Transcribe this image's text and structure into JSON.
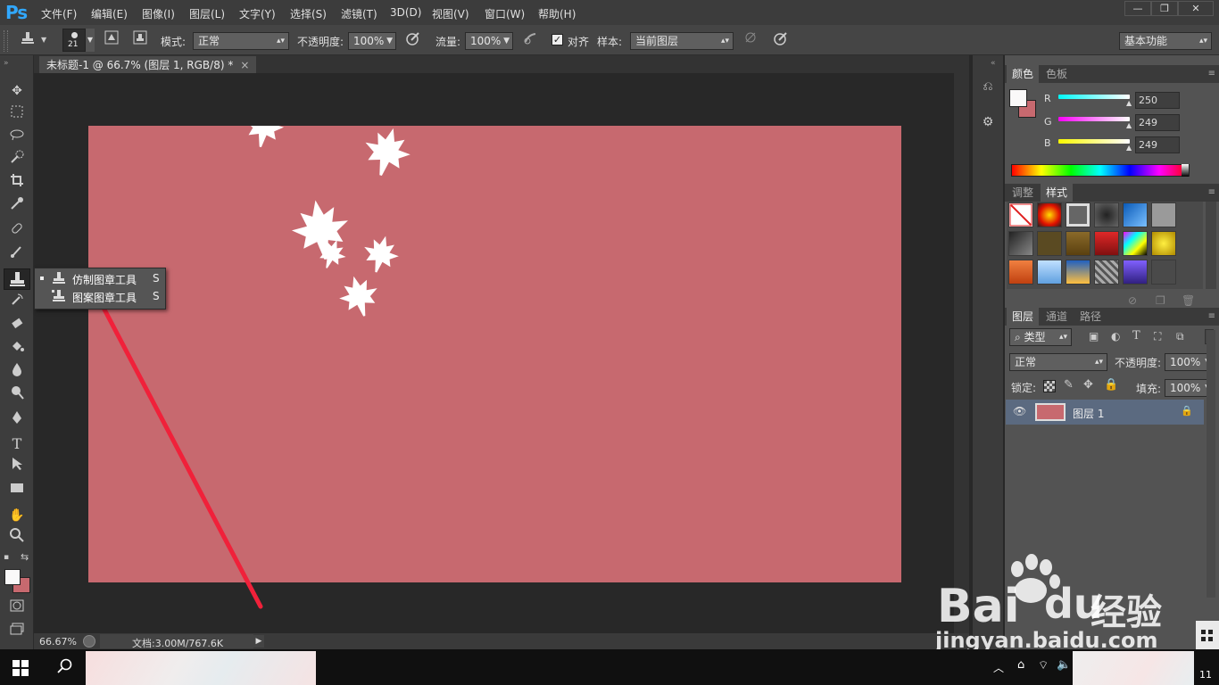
{
  "app": {
    "logo": "Ps"
  },
  "menu": [
    "文件(F)",
    "编辑(E)",
    "图像(I)",
    "图层(L)",
    "文字(Y)",
    "选择(S)",
    "滤镜(T)",
    "3D(D)",
    "视图(V)",
    "窗口(W)",
    "帮助(H)"
  ],
  "window_controls": {
    "minimize": "—",
    "restore": "❐",
    "close": "✕"
  },
  "options": {
    "brush_size": "21",
    "mode_label": "模式:",
    "mode_value": "正常",
    "opacity_label": "不透明度:",
    "opacity_value": "100%",
    "flow_label": "流量:",
    "flow_value": "100%",
    "align_label": "对齐",
    "sample_label": "样本:",
    "sample_value": "当前图层",
    "workspace": "基本功能"
  },
  "document": {
    "tab_title": "未标题-1 @ 66.7% (图层 1, RGB/8) *",
    "canvas_color": "#c7696f"
  },
  "status": {
    "zoom": "66.67%",
    "doc_info": "文档:3.00M/767.6K"
  },
  "flyout": {
    "items": [
      {
        "label": "仿制图章工具",
        "shortcut": "S"
      },
      {
        "label": "图案图章工具",
        "shortcut": "S"
      }
    ]
  },
  "color_panel": {
    "tabs": [
      "颜色",
      "色板"
    ],
    "r_label": "R",
    "r_value": "250",
    "g_label": "G",
    "g_value": "249",
    "b_label": "B",
    "b_value": "249"
  },
  "styles_panel": {
    "tabs": [
      "调整",
      "样式"
    ]
  },
  "layers_panel": {
    "tabs": [
      "图层",
      "通道",
      "路径"
    ],
    "filter_kind": "类型",
    "blend_mode": "正常",
    "opacity_label": "不透明度:",
    "opacity_value": "100%",
    "lock_label": "锁定:",
    "fill_label": "填充:",
    "fill_value": "100%",
    "layers": [
      {
        "name": "图层 1"
      }
    ]
  },
  "watermark": {
    "brand": "Bai",
    "brand2": "du",
    "suffix": "经验",
    "url": "jingyan.baidu.com"
  },
  "taskbar": {
    "clock": "11"
  },
  "colors": {
    "accent_blue": "#31a8ff",
    "arrow_red": "#f0213a"
  }
}
